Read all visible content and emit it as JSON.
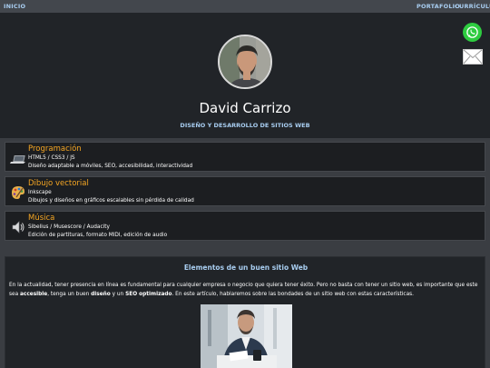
{
  "nav": {
    "home": "INICIO",
    "portfolio": "PORTAFOLIO",
    "resume": "CURRÍCULUM"
  },
  "profile": {
    "name": "David Carrizo",
    "tagline": "DISEÑO Y DESARROLLO DE SITIOS WEB"
  },
  "contact": {
    "whatsapp_icon": "whatsapp-icon",
    "mail_icon": "mail-icon",
    "whatsapp_color": "#2ecc40"
  },
  "skills": [
    {
      "icon": "laptop-icon",
      "title": "Programación",
      "tools": "HTML5 / CSS3 / JS",
      "description": "Diseño adaptable a móviles, SEO, accesibilidad, interactividad"
    },
    {
      "icon": "palette-icon",
      "title": "Dibujo vectorial",
      "tools": "Inkscape",
      "description": "Dibujos y diseños en gráficos escalables sin pérdida de calidad"
    },
    {
      "icon": "speaker-icon",
      "title": "Música",
      "tools": "Sibelius / Musescore / Audacity",
      "description": "Edición de partituras, formato MIDI, edición de audio"
    }
  ],
  "article": {
    "title": "Elementos de un buen sitio Web",
    "body_part1": "En la actualidad, tener presencia en línea es fundamental para cualquier empresa o negocio que quiera tener éxito. Pero no basta con tener un sitio web, es importante que este sea ",
    "bold1": "accesible",
    "body_part2": ", tenga un buen ",
    "bold2": "diseño",
    "body_part3": " y un ",
    "bold3": "SEO optimizado",
    "body_part4": ". En este artículo, hablaremos sobre las bondades de un sitio web con estas características."
  },
  "colors": {
    "accent_blue": "#a8cdf0",
    "accent_orange": "#f5a623",
    "hero_bg": "#212428",
    "page_bg": "#3a3d42"
  }
}
